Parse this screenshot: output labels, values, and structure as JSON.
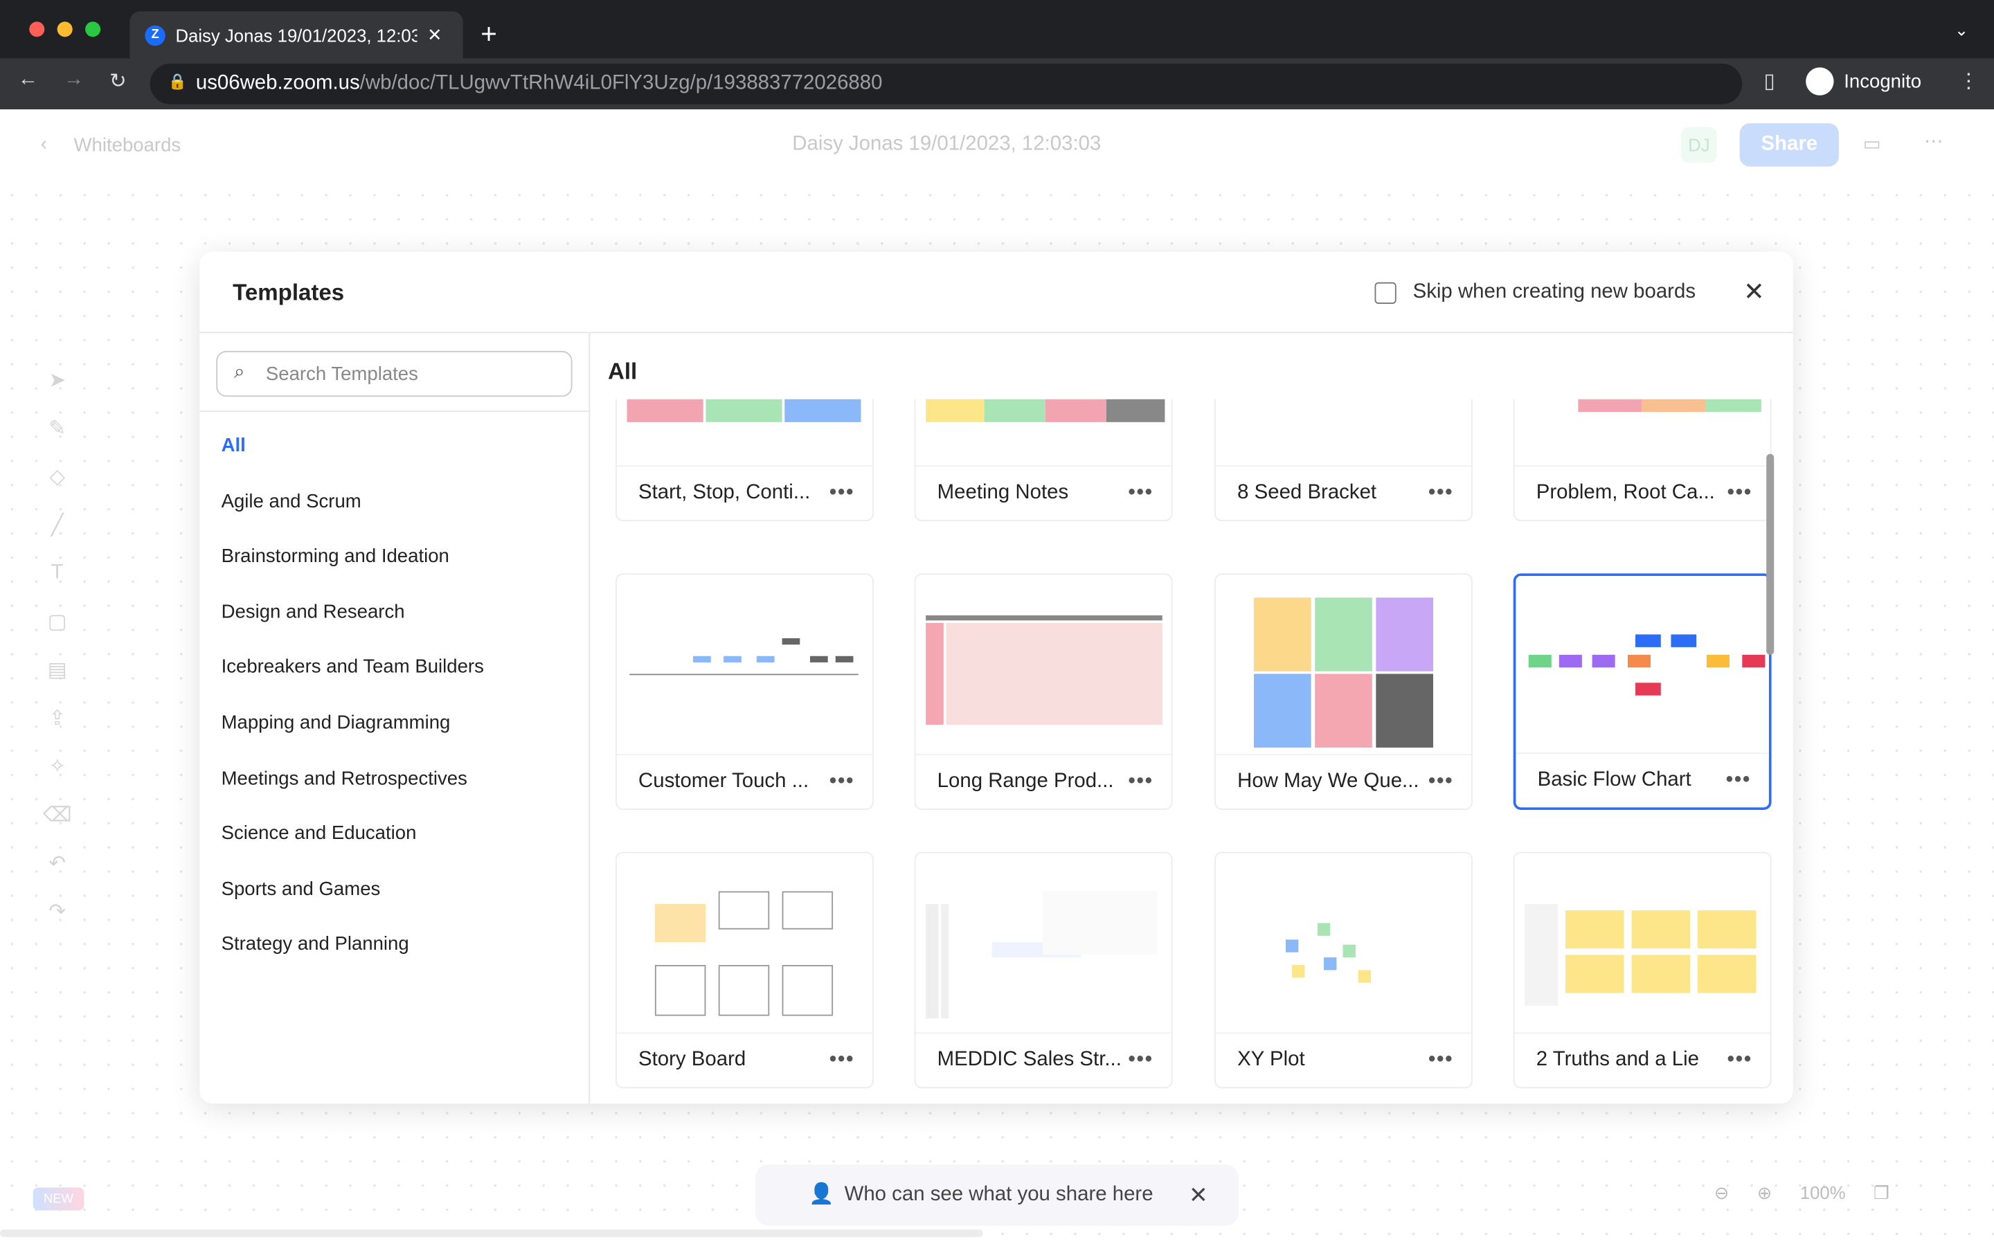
{
  "browser": {
    "tab_title": "Daisy Jonas 19/01/2023, 12:03",
    "url_host": "us06web.zoom.us",
    "url_path": "/wb/doc/TLUgwvTtRhW4iL0FlY3Uzg/p/193883772026880",
    "incognito_label": "Incognito"
  },
  "app": {
    "back_label": "Whiteboards",
    "title": "Daisy Jonas 19/01/2023, 12:03:03",
    "avatar": "DJ",
    "share_label": "Share"
  },
  "modal": {
    "title": "Templates",
    "skip_label": "Skip when creating new boards",
    "skip_checked": false,
    "search_placeholder": "Search Templates",
    "section_title": "All",
    "categories": [
      "All",
      "Agile and Scrum",
      "Brainstorming and Ideation",
      "Design and Research",
      "Icebreakers and Team Builders",
      "Mapping and Diagramming",
      "Meetings and Retrospectives",
      "Science and Education",
      "Sports and Games",
      "Strategy and Planning"
    ],
    "selected_category": "All",
    "templates": [
      {
        "name": "Start, Stop, Conti..."
      },
      {
        "name": "Meeting Notes"
      },
      {
        "name": "8 Seed Bracket"
      },
      {
        "name": "Problem, Root Ca..."
      },
      {
        "name": "Customer Touch ..."
      },
      {
        "name": "Long Range Prod..."
      },
      {
        "name": "How May We Que..."
      },
      {
        "name": "Basic Flow Chart",
        "selected": true
      },
      {
        "name": "Story Board"
      },
      {
        "name": "MEDDIC Sales Str..."
      },
      {
        "name": "XY Plot"
      },
      {
        "name": "2 Truths and a Lie"
      }
    ]
  },
  "footer": {
    "new_badge": "NEW",
    "share_notice": "Who can see what you share here",
    "zoom_level": "100%"
  },
  "colors": {
    "accent": "#2d6cf6",
    "share_button": "#c9dcfb"
  }
}
